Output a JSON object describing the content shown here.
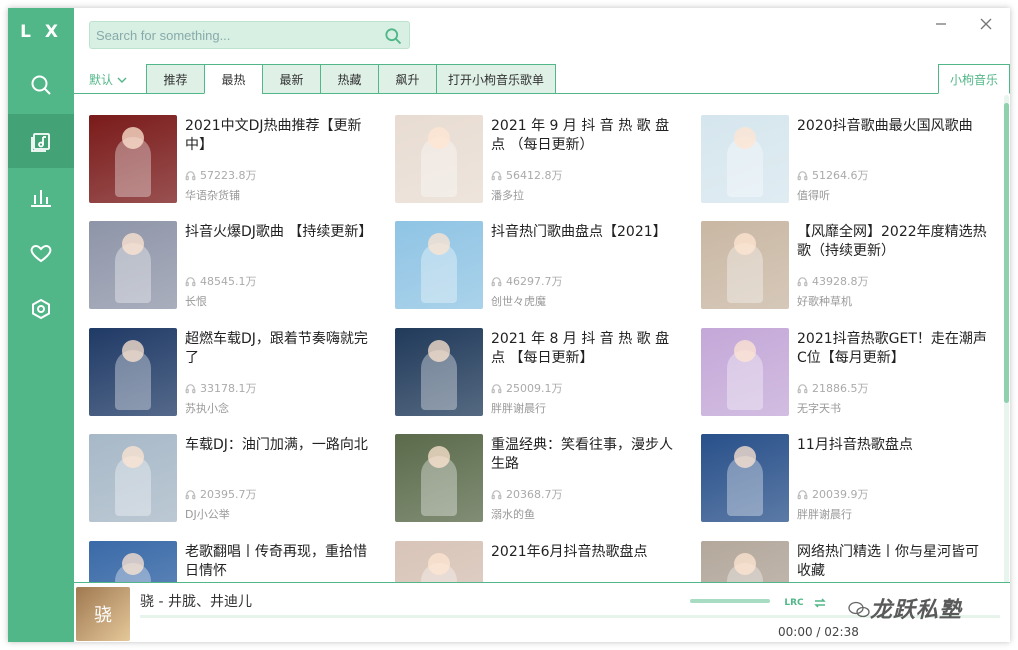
{
  "app": {
    "logo": "L X"
  },
  "search": {
    "placeholder": "Search for something..."
  },
  "sort": {
    "selected": "默认"
  },
  "tabs": [
    "推荐",
    "最热",
    "最新",
    "热藏",
    "飙升",
    "打开小枸音乐歌单"
  ],
  "active_tab_index": 1,
  "source_tab": "小枸音乐",
  "playlists": [
    {
      "title": "2021中文DJ热曲推荐【更新中】",
      "plays": "57223.8万",
      "author": "华语杂货铺"
    },
    {
      "title": "2021 年 9 月 抖 音 热 歌 盘 点 （每日更新）",
      "plays": "56412.8万",
      "author": "潘多拉"
    },
    {
      "title": "2020抖音歌曲最火国风歌曲",
      "plays": "51264.6万",
      "author": "值得听"
    },
    {
      "title": "抖音火爆DJ歌曲 【持续更新】",
      "plays": "48545.1万",
      "author": "长恨"
    },
    {
      "title": "抖音热门歌曲盘点【2021】",
      "plays": "46297.7万",
      "author": "创世々虎魔"
    },
    {
      "title": "【风靡全网】2022年度精选热歌（持续更新）",
      "plays": "43928.8万",
      "author": "好歌种草机"
    },
    {
      "title": "超燃车载DJ，跟着节奏嗨就完了",
      "plays": "33178.1万",
      "author": "苏执小念"
    },
    {
      "title": "2021 年 8 月 抖 音 热 歌 盘 点 【每日更新】",
      "plays": "25009.1万",
      "author": "胖胖谢晨行"
    },
    {
      "title": "2021抖音热歌GET！走在潮声C位【每月更新】",
      "plays": "21886.5万",
      "author": "无字天书"
    },
    {
      "title": "车载DJ：油门加满，一路向北",
      "plays": "20395.7万",
      "author": "DJ小公举"
    },
    {
      "title": "重温经典：笑看往事，漫步人生路",
      "plays": "20368.7万",
      "author": "溺水的鱼"
    },
    {
      "title": "11月抖音热歌盘点",
      "plays": "20039.9万",
      "author": "胖胖谢晨行"
    },
    {
      "title": "老歌翻唱丨传奇再现，重拾惜日情怀",
      "plays": "",
      "author": ""
    },
    {
      "title": "2021年6月抖音热歌盘点",
      "plays": "",
      "author": ""
    },
    {
      "title": "网络热门精选丨你与星河皆可收藏",
      "plays": "",
      "author": ""
    }
  ],
  "covers": [
    "#7a1a1a",
    "#e8dcd2",
    "#d6e6ee",
    "#8e95a8",
    "#8fc4e4",
    "#c9b7a3",
    "#1f3a66",
    "#203a5a",
    "#c4a8d8",
    "#a7b8c7",
    "#5a6a4a",
    "#28508a",
    "#3a6aa8",
    "#d8c4b8",
    "#b4a89c"
  ],
  "player": {
    "title": "骁 - 井胧、井迪儿",
    "cover_text": "骁",
    "time_current": "00:00",
    "time_total": "02:38",
    "lrc_label": "LRC"
  },
  "watermark": "龙跃私塾",
  "colors": {
    "accent": "#52b788",
    "accent_dark": "#44a376"
  }
}
